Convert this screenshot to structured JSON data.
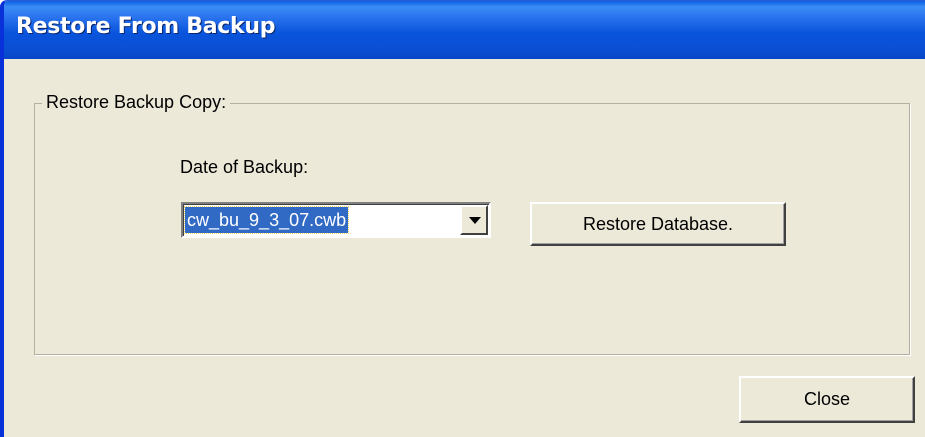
{
  "dialog": {
    "title": "Restore From Backup",
    "group_label": "Restore Backup Copy:",
    "date_label": "Date of Backup:",
    "backup_select": {
      "value": "cw_bu_9_3_07.cwb",
      "icon": "chevron-down-icon"
    },
    "restore_button_label": "Restore Database.",
    "close_button_label": "Close"
  },
  "colors": {
    "titlebar": "#0854dc",
    "dialog_bg": "#ece9d8",
    "selection": "#316ac5"
  }
}
